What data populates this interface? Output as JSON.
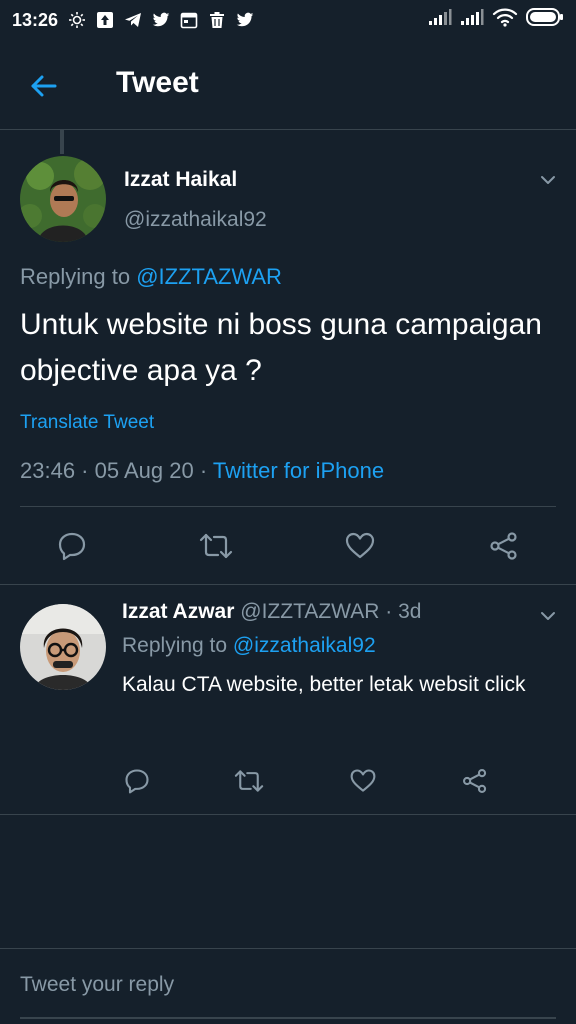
{
  "status_bar": {
    "time": "13:26",
    "icons": [
      "brightness-icon",
      "upload-icon",
      "telegram-icon",
      "twitter-icon",
      "calendar-icon",
      "trash-icon",
      "twitter-icon"
    ],
    "right_icons": [
      "signal-icon",
      "signal-icon",
      "wifi-icon",
      "battery-icon"
    ]
  },
  "header": {
    "title": "Tweet"
  },
  "main_tweet": {
    "name": "Izzat Haikal",
    "handle": "@izzathaikal92",
    "replying_prefix": "Replying to ",
    "replying_to": "@IZZTAZWAR",
    "text": "Untuk website ni boss guna campaigan objective apa ya ?",
    "translate": "Translate Tweet",
    "time": "23:46",
    "date": "05 Aug 20",
    "separator": " · ",
    "source": "Twitter for iPhone"
  },
  "reply_tweet": {
    "name": "Izzat Azwar",
    "handle": "@IZZTAZWAR",
    "age": "3d",
    "separator": " · ",
    "replying_prefix": "Replying to ",
    "replying_to": "@izzathaikal92",
    "text": "Kalau CTA website, better letak websit click"
  },
  "compose": {
    "placeholder": "Tweet your reply"
  },
  "colors": {
    "background": "#15202b",
    "border": "#38444d",
    "accent": "#1da1f2",
    "secondary_text": "#8899a6",
    "icon": "#8899a6"
  }
}
